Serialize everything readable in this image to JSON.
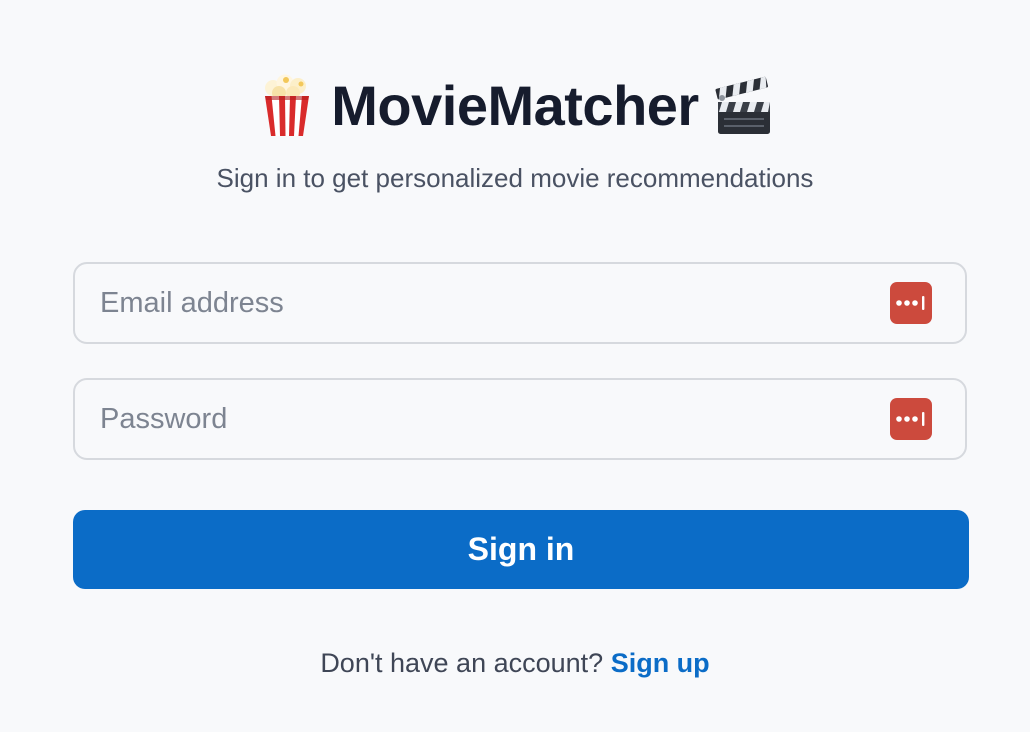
{
  "header": {
    "title": "MovieMatcher",
    "left_icon": "popcorn-icon",
    "right_icon": "clapper-board-icon",
    "subtitle": "Sign in to get personalized movie recommendations"
  },
  "form": {
    "email": {
      "placeholder": "Email address",
      "value": "",
      "accessory_icon": "password-manager-icon"
    },
    "password": {
      "placeholder": "Password",
      "value": "",
      "accessory_icon": "password-manager-icon"
    },
    "submit_label": "Sign in"
  },
  "footer": {
    "prompt": "Don't have an account?",
    "link_label": "Sign up"
  },
  "colors": {
    "background": "#f8f9fb",
    "primary": "#0b6cc7",
    "title": "#161c2d",
    "password_manager": "#cc4a3d"
  }
}
